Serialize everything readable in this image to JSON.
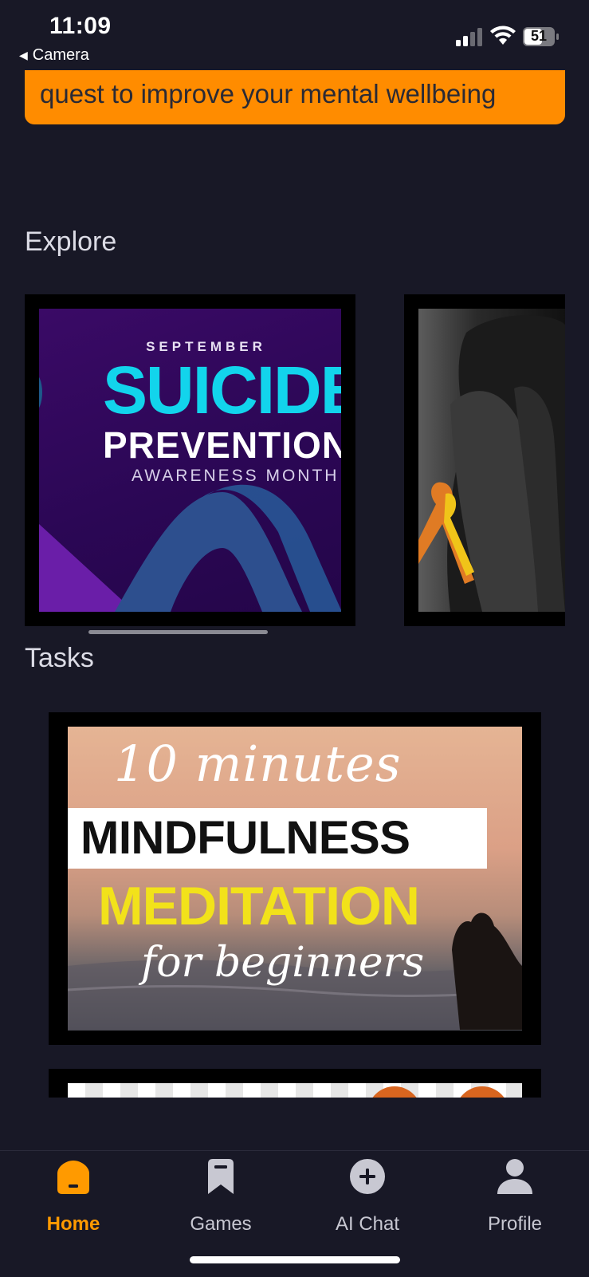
{
  "status_bar": {
    "time": "11:09",
    "back_label": "Camera",
    "battery": "51"
  },
  "banner": {
    "text": "quest to improve your mental wellbeing",
    "color": "#FF8C00"
  },
  "explore": {
    "title": "Explore",
    "cards": [
      {
        "month": "SEPTEMBER",
        "headline": "SUICIDE",
        "subheadline": "PREVENTION",
        "caption": "AWARENESS MONTH"
      },
      {
        "image": "man-hands-face-with-ribbon"
      }
    ]
  },
  "tasks": {
    "title": "Tasks",
    "cards": [
      {
        "line1": "10 minutes",
        "line2": "MINDFULNESS",
        "line3": "MEDITATION",
        "line4": "for beginners"
      },
      {
        "image": "checkered-banner"
      }
    ]
  },
  "tab_bar": {
    "items": [
      {
        "label": "Home",
        "icon": "home-icon",
        "active": true
      },
      {
        "label": "Games",
        "icon": "bookmark-icon",
        "active": false
      },
      {
        "label": "AI Chat",
        "icon": "plus-circle-icon",
        "active": false
      },
      {
        "label": "Profile",
        "icon": "person-icon",
        "active": false
      }
    ],
    "active_color": "#FF9A00",
    "inactive_color": "#C8C8D2"
  },
  "colors": {
    "background": "#181826",
    "accent": "#FF8C00"
  }
}
